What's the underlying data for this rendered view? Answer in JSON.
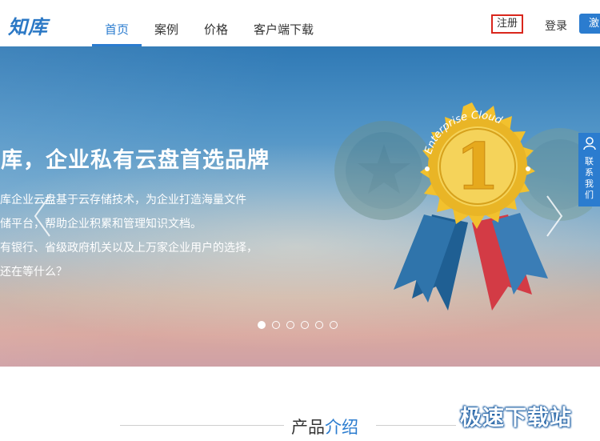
{
  "header": {
    "logo": "知库",
    "nav": [
      {
        "label": "首页",
        "active": true
      },
      {
        "label": "案例",
        "active": false
      },
      {
        "label": "价格",
        "active": false
      },
      {
        "label": "客户端下载",
        "active": false
      }
    ],
    "register_label": "注册",
    "login_label": "登录",
    "trial_label": "激"
  },
  "banner": {
    "headline": "知库，企业私有云盘首选品牌",
    "lines": [
      "知库企业云盘基于云存储技术，为企业打造海量文件",
      "存储平台，帮助企业积累和管理知识文档。",
      "已有银行、省级政府机关以及上万家企业用户的选择，",
      "你还在等什么？"
    ],
    "badge_text": "Enterprise Cloud",
    "badge_number": "1",
    "contact_label": "联系我们",
    "slide_count": 6,
    "active_slide": 0
  },
  "section": {
    "title_plain": "产品",
    "title_highlight": "介绍"
  },
  "watermark": "极速下载站",
  "colors": {
    "accent": "#2b7ccf",
    "register_border": "#d9261c"
  }
}
